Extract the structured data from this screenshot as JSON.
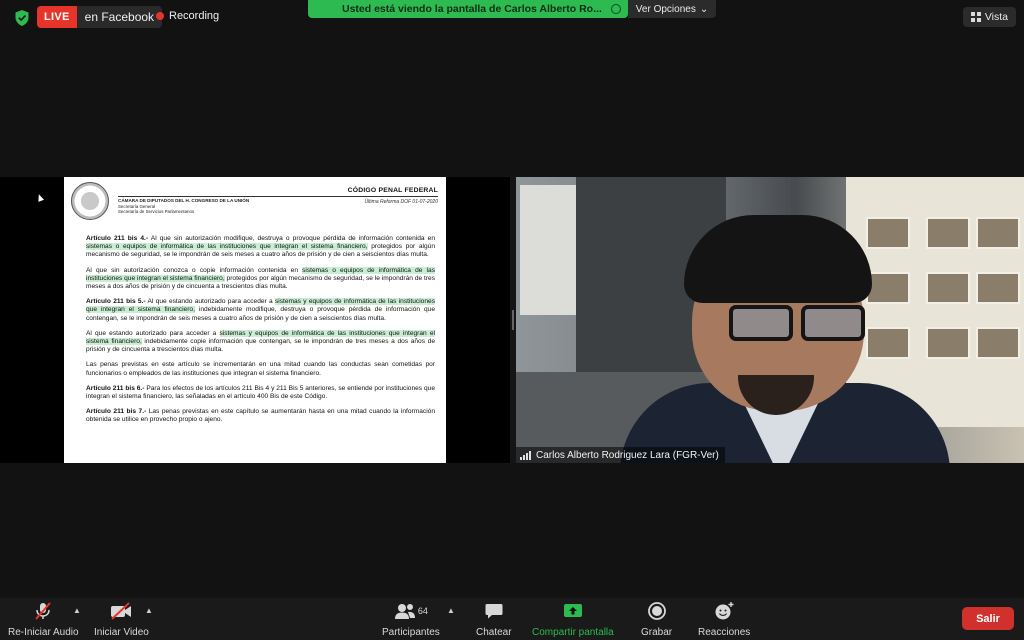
{
  "top_bar": {
    "live_badge": "LIVE",
    "live_platform": "en Facebook",
    "recording_label": "Recording",
    "share_banner": "Usted está viendo la pantalla de Carlos Alberto Ro...",
    "options_label": "Ver Opciones",
    "view_label": "Vista"
  },
  "document": {
    "header": {
      "institution_line1": "CÁMARA DE DIPUTADOS DEL H. CONGRESO DE LA UNIÓN",
      "institution_line2": "Secretaría General",
      "institution_line3": "Secretaría de Servicios Parlamentarios",
      "code_title": "CÓDIGO PENAL FEDERAL",
      "reform_date": "Última Reforma DOF 01-07-2020"
    },
    "p1": {
      "lead": "Artículo 211 bis 4.-",
      "t1": " Al que sin autorización modifique, destruya o provoque pérdida de información contenida en ",
      "h1": "sistemas o equipos de informática de las instituciones que integran el sistema financiero,",
      "t2": " protegidos por algún mecanismo de seguridad, se le impondrán de seis meses a cuatro años de prisión y de cien a seiscientos días multa."
    },
    "p2": {
      "t1": "Al que sin autorización conozca o copie información contenida en ",
      "h1": "sistemas o equipos de informática de las instituciones que integran el sistema financiero,",
      "t2": " protegidos por algún mecanismo de seguridad, se le impondrán de tres meses a dos años de prisión y de cincuenta a trescientos días multa."
    },
    "p3": {
      "lead": "Artículo 211 bis 5.-",
      "t1": " Al que estando autorizado para acceder a ",
      "h1": "sistemas y equipos de informática de las instituciones que integran el sistema financiero,",
      "t2": " indebidamente modifique, destruya o provoque pérdida de información que contengan, se le impondrán de seis meses a cuatro años de prisión y de cien a seiscientos días multa."
    },
    "p4": {
      "t1": "Al que estando autorizado para acceder a ",
      "h1": "sistemas y equipos de informática de las instituciones que integran el sistema financiero,",
      "t2": " indebidamente copie información que contengan, se le impondrán de tres meses a dos años de prisión y de cincuenta a trescientos días multa."
    },
    "p5": {
      "t1": "Las penas previstas en este artículo se incrementarán en una mitad cuando las conductas sean cometidas por funcionarios o empleados de las instituciones que integran el sistema financiero."
    },
    "p6": {
      "lead": "Artículo 211 bis 6.-",
      "t1": " Para los efectos de los artículos 211 Bis 4 y 211 Bis 5 anteriores, se entiende por instituciones que integran el sistema financiero, las señaladas en el artículo 400 Bis de este Código."
    },
    "p7": {
      "lead": "Artículo 211 bis 7.-",
      "t1": " Las penas previstas en este capítulo se aumentarán hasta en una mitad cuando la información obtenida se utilice en provecho propio o ajeno."
    }
  },
  "video": {
    "participant_name": "Carlos Alberto Rodriguez Lara (FGR-Ver)"
  },
  "toolbar": {
    "audio_label": "Re-Iniciar Audio",
    "video_label": "Iniciar Video",
    "participants_label": "Participantes",
    "participants_count": "64",
    "chat_label": "Chatear",
    "share_label": "Compartir pantalla",
    "record_label": "Grabar",
    "reactions_label": "Reacciones",
    "exit_label": "Salir"
  },
  "colors": {
    "live_red": "#e5342a",
    "banner_green": "#2dbb51",
    "highlight_green": "#c9eed4",
    "exit_red": "#d0312d"
  }
}
